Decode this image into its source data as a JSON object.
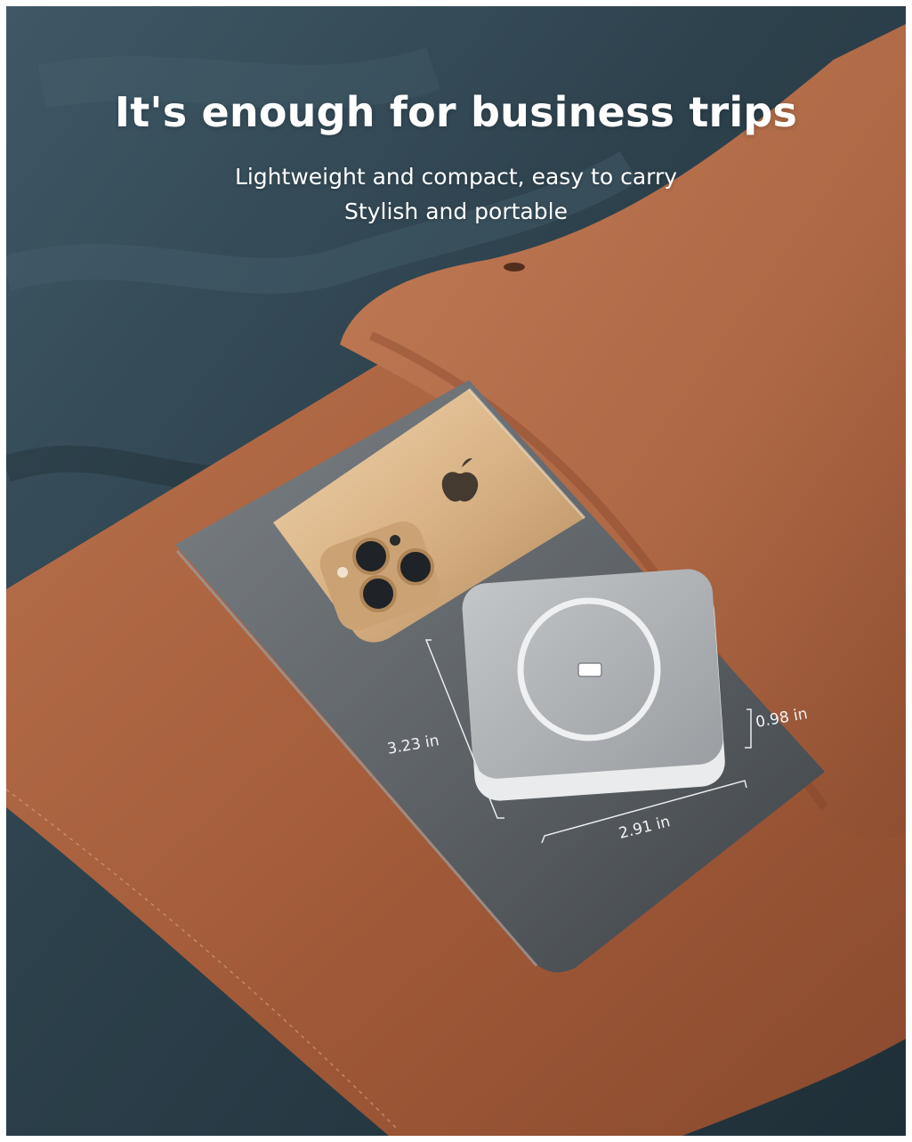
{
  "headline": "It's enough for business trips",
  "subline_1": "Lightweight and compact, easy to carry",
  "subline_2": "Stylish and portable",
  "dimensions": {
    "height": "3.23 in",
    "width": "2.91 in",
    "thickness": "0.98 in"
  },
  "colors": {
    "fabric": "#2f4450",
    "leather": "#a9623f",
    "tablet": "#62676c",
    "phone": "#d8b489",
    "charger_fabric": "#aeb1b4",
    "charger_ring": "#eef0f2"
  }
}
